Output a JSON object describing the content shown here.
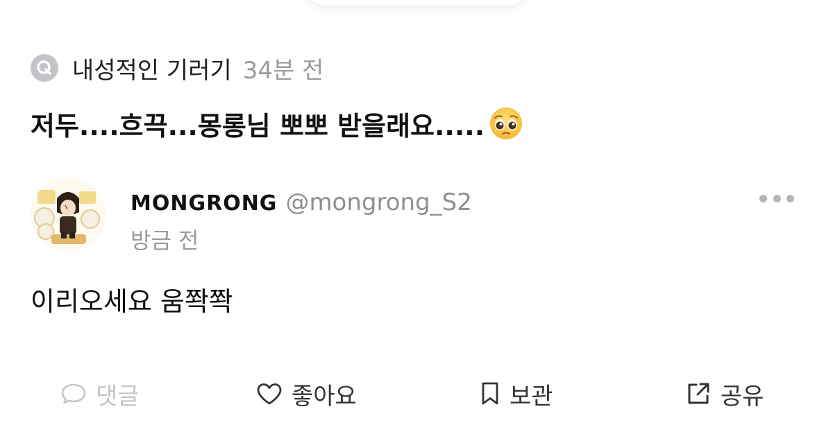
{
  "question": {
    "badge": "Q",
    "author": "내성적인 기러기",
    "time": "34분 전",
    "text": "저두....흐끅...몽롱님 뽀뽀 받을래요.....",
    "emoji": "pleading-face-emoji"
  },
  "answer": {
    "name": "MONGRONG",
    "handle": "@mongrong_S2",
    "time": "방금 전",
    "body": "이리오세요 움쫙쫙",
    "avatar": "cartoon-avatar"
  },
  "actions": {
    "comment": "댓글",
    "like": "좋아요",
    "save": "보관",
    "share": "공유"
  },
  "colors": {
    "muted": "#9a9aa0",
    "disabled": "#c4c4c8",
    "text": "#111111"
  }
}
